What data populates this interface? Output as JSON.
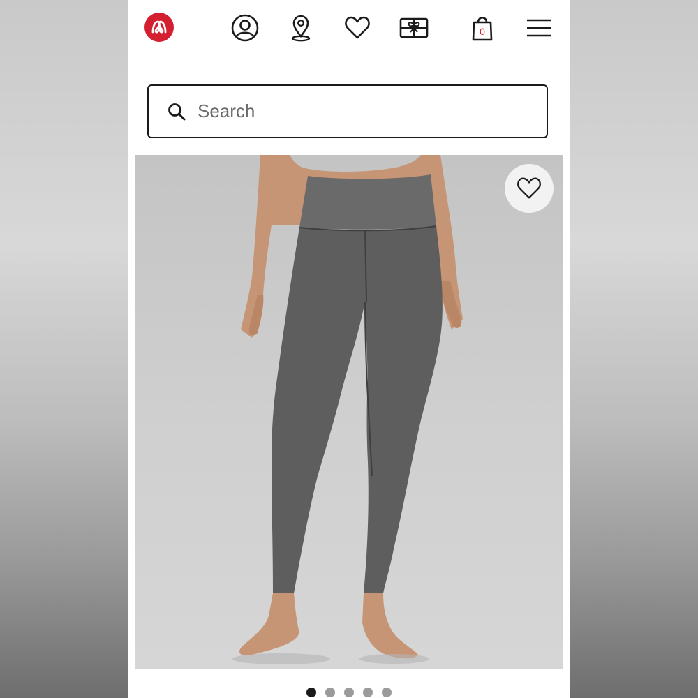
{
  "brand": {
    "logo_icon": "lululemon-logo-icon",
    "brand_color": "#d31f30"
  },
  "header": {
    "icons": [
      "account-icon",
      "store-locator-icon",
      "wishlist-heart-icon",
      "gift-card-icon",
      "shopping-bag-icon",
      "menu-icon"
    ],
    "cart_count": "0"
  },
  "search": {
    "placeholder": "Search"
  },
  "product_image": {
    "subject": "leggings-product-photo",
    "favorite_icon": "heart-icon",
    "carousel": {
      "total": 5,
      "active_index": 0
    }
  }
}
